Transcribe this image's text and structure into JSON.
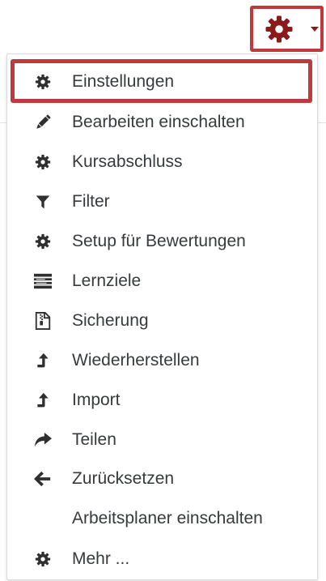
{
  "colors": {
    "brand": "#8b1a1a",
    "highlight_border": "#c0393b",
    "text": "#373a3c",
    "icon": "#2f2f2f"
  },
  "trigger": {
    "icon": "cog-icon",
    "caret_icon": "caret-down-icon"
  },
  "menu": {
    "items": [
      {
        "label": "Einstellungen",
        "icon": "cog-icon",
        "highlighted": true
      },
      {
        "label": "Bearbeiten einschalten",
        "icon": "pencil-icon"
      },
      {
        "label": "Kursabschluss",
        "icon": "cog-icon"
      },
      {
        "label": "Filter",
        "icon": "filter-icon"
      },
      {
        "label": "Setup für Bewertungen",
        "icon": "cog-icon"
      },
      {
        "label": "Lernziele",
        "icon": "list-icon"
      },
      {
        "label": "Sicherung",
        "icon": "file-archive-icon"
      },
      {
        "label": "Wiederherstellen",
        "icon": "level-up-icon"
      },
      {
        "label": "Import",
        "icon": "level-up-icon"
      },
      {
        "label": "Teilen",
        "icon": "share-icon"
      },
      {
        "label": "Zurücksetzen",
        "icon": "arrow-left-icon"
      },
      {
        "label": "Arbeitsplaner einschalten",
        "icon": ""
      },
      {
        "label": "Mehr ...",
        "icon": "cog-icon"
      }
    ]
  }
}
